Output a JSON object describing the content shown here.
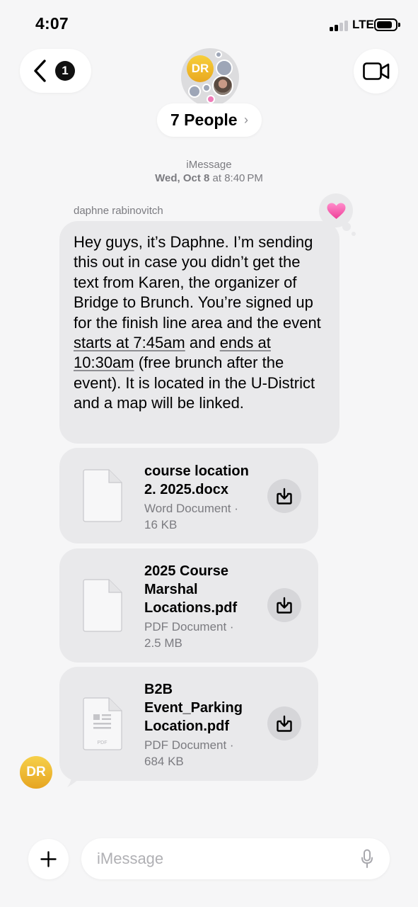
{
  "status_bar": {
    "time": "4:07",
    "network": "LTE"
  },
  "header": {
    "back_badge": "1",
    "group_initials": "DR",
    "group_title": "7 People",
    "group_chevron": "›"
  },
  "conversation": {
    "service": "iMessage",
    "date_prefix": "Wed, Oct 8",
    "date_suffix": " at 8:40 PM",
    "sender": "daphne rabinovitch",
    "tapback": "heart",
    "message_text_1": "Hey guys, it’s Daphne. I’m sending this out in case you didn’t get the text from Karen, the organizer of Bridge to Brunch. You’re signed up for the finish line area and the event ",
    "message_link_1": "starts at 7:45am",
    "message_text_2": " and ",
    "message_link_2": "ends at 10:30am",
    "message_text_3": " (free brunch after the event). It is located in the U-District and a map will be linked.",
    "attachments": [
      {
        "name": "course location 2. 2025.docx",
        "type": "Word Document ·",
        "size": "16 KB",
        "icon": "document-icon"
      },
      {
        "name": "2025 Course Marshal Locations.pdf",
        "type": "PDF Document ·",
        "size": "2.5 MB",
        "icon": "document-icon"
      },
      {
        "name": "B2B Event_Parking Location.pdf",
        "type": "PDF Document ·",
        "size": "684 KB",
        "icon": "pdf-document-icon",
        "icon_text": "PDF"
      }
    ],
    "sender_initials": "DR"
  },
  "composer": {
    "placeholder": "iMessage"
  },
  "colors": {
    "background": "#f6f6f7",
    "bubble_gray": "#e9e9eb",
    "secondary_text": "#7b7b80",
    "avatar_yellow": "#f0b92e",
    "tapback_pink": "#f25aa8"
  }
}
